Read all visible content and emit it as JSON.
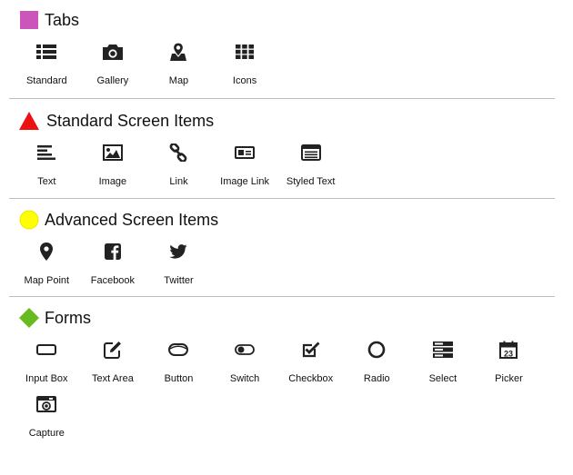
{
  "sections": [
    {
      "title": "Tabs",
      "color": "#cc55bb",
      "shape": "square",
      "items": [
        {
          "label": "Standard",
          "icon": "list-icon"
        },
        {
          "label": "Gallery",
          "icon": "camera-icon"
        },
        {
          "label": "Map",
          "icon": "map-icon"
        },
        {
          "label": "Icons",
          "icon": "grid-icon"
        }
      ]
    },
    {
      "title": "Standard Screen Items",
      "color": "#ee1111",
      "shape": "triangle",
      "items": [
        {
          "label": "Text",
          "icon": "text-align-icon"
        },
        {
          "label": "Image",
          "icon": "image-icon"
        },
        {
          "label": "Link",
          "icon": "link-icon"
        },
        {
          "label": "Image Link",
          "icon": "image-link-icon"
        },
        {
          "label": "Styled Text",
          "icon": "styled-text-icon"
        }
      ]
    },
    {
      "title": "Advanced Screen Items",
      "color": "#ffff00",
      "shape": "circle",
      "items": [
        {
          "label": "Map Point",
          "icon": "map-marker-icon"
        },
        {
          "label": "Facebook",
          "icon": "facebook-icon"
        },
        {
          "label": "Twitter",
          "icon": "twitter-icon"
        }
      ]
    },
    {
      "title": "Forms",
      "color": "#66bb22",
      "shape": "diamond",
      "items": [
        {
          "label": "Input Box",
          "icon": "input-box-icon"
        },
        {
          "label": "Text Area",
          "icon": "edit-icon"
        },
        {
          "label": "Button",
          "icon": "button-icon"
        },
        {
          "label": "Switch",
          "icon": "toggle-icon"
        },
        {
          "label": "Checkbox",
          "icon": "checkbox-icon"
        },
        {
          "label": "Radio",
          "icon": "radio-icon"
        },
        {
          "label": "Select",
          "icon": "select-icon"
        },
        {
          "label": "Picker",
          "icon": "calendar-icon"
        },
        {
          "label": "Capture",
          "icon": "capture-icon"
        }
      ]
    }
  ],
  "calendar_day": "23"
}
